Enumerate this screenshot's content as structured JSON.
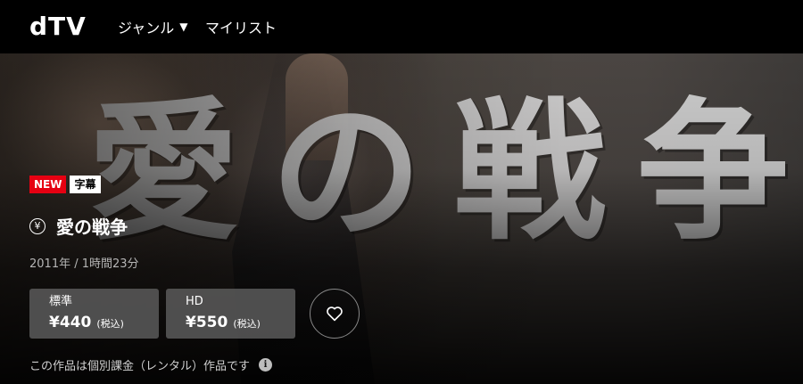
{
  "header": {
    "logo": "dTV",
    "nav_genre": "ジャンル",
    "nav_mylist": "マイリスト"
  },
  "hero": {
    "title_art": [
      "愛",
      "の",
      "戦",
      "争"
    ]
  },
  "content": {
    "badge_new": "NEW",
    "badge_subtitle": "字幕",
    "title": "愛の戦争",
    "meta": "2011年 / 1時間23分",
    "notice": "この作品は個別課金（レンタル）作品です"
  },
  "prices": {
    "standard": {
      "label": "標準",
      "value": "¥440",
      "tax": "(税込)"
    },
    "hd": {
      "label": "HD",
      "value": "¥550",
      "tax": "(税込)"
    }
  },
  "colors": {
    "badge_new": "#e60012",
    "header_bg": "#000000",
    "button_bg": "#5a5a5a"
  }
}
